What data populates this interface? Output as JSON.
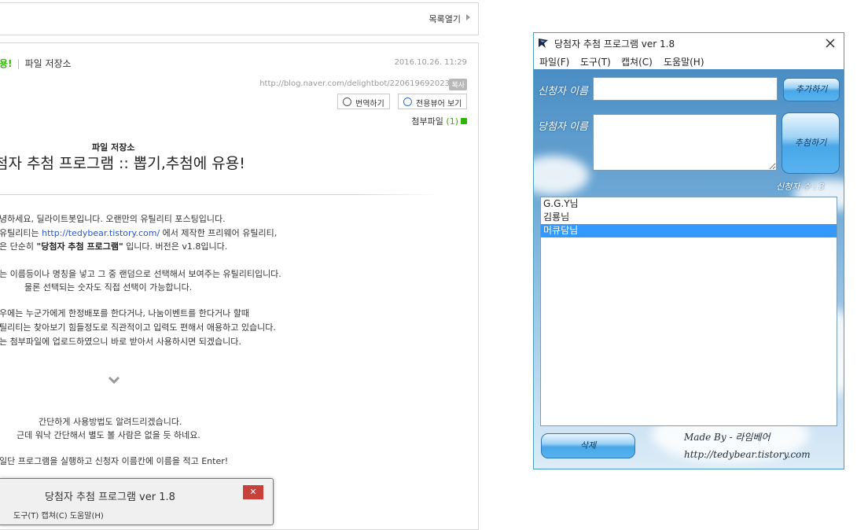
{
  "blog": {
    "toc_label": "목록열기",
    "category_label": "파일 저장소",
    "category_prefix": "용!",
    "date": "2016.10.26. 11:29",
    "url": "http://blog.naver.com/delightbot/220619692023",
    "copy_badge": "복사",
    "translate_label": "번역하기",
    "viewer_label": "전용뷰어 보기",
    "attach_label": "첨부파일",
    "attach_count": "(1)",
    "post_category": "파일 저장소",
    "post_title": "첨자 추첨 프로그램 :: 뽑기,추첨에 유용!",
    "p1": "녕하세요, 딜라이트봇입니다. 오랜만의 유틸리티 포스팅입니다.",
    "p2_pre": " 유틸리티는 ",
    "p2_link": "http://tedybear.tistory.com/",
    "p2_post": " 에서 제작한 프리웨어 유틸리티,",
    "p3_pre": "은 단순히 ",
    "p3_bold": "\"당첨자 추첨 프로그램\"",
    "p3_post": " 입니다. 버전은 v1.8입니다.",
    "p4": "는 이름등이나 명칭을 넣고 그 중 랜덤으로 선택해서 보여주는 유틸리티입니다.",
    "p5": "물론 선택되는 숫자도 직접 선택이 가능합니다.",
    "p6": "우에는 누군가에게 한정배포를 한다거나, 나눔이벤트를 한다거나 할때",
    "p7": "틸리티는 찾아보기 힘들정도로 직관적이고 입력도 편해서 애용하고 있습니다.",
    "p8": "는 첨부파일에 업로드하였으니 바로 받아서 사용하시면 되겠습니다.",
    "c1": "간단하게 사용방법도 알려드리겠습니다.",
    "c2": "근데 워낙 간단해서 별도 볼 사람은 없을 듯 하네요.",
    "c3": "일단 프로그램을 실행하고 신청자 이름칸에 이름을 적고 Enter!",
    "inner_title": "당첨자 추첨 프로그램 ver 1.8",
    "inner_close": "✕",
    "inner_menu": "도구(T)   캡쳐(C)   도움말(H)"
  },
  "app": {
    "title": "당첨자 추첨 프로그램 ver 1.8",
    "menu": [
      "파일(F)",
      "도구(T)",
      "캡쳐(C)",
      "도움말(H)"
    ],
    "applicant_label": "신청자 이름",
    "winner_label": "당첨자 이름",
    "add_button": "추가하기",
    "draw_button": "추첨하기",
    "delete_button": "삭제",
    "count_text": "신청자 수 : 3",
    "applicant_value": "",
    "winner_value": "",
    "list": [
      "G.G.Y님",
      "김룡님",
      "머큐담님"
    ],
    "selected_index": 2,
    "made_by": "Made By - 라임베어",
    "site": "http://tedybear.tistory.com"
  }
}
